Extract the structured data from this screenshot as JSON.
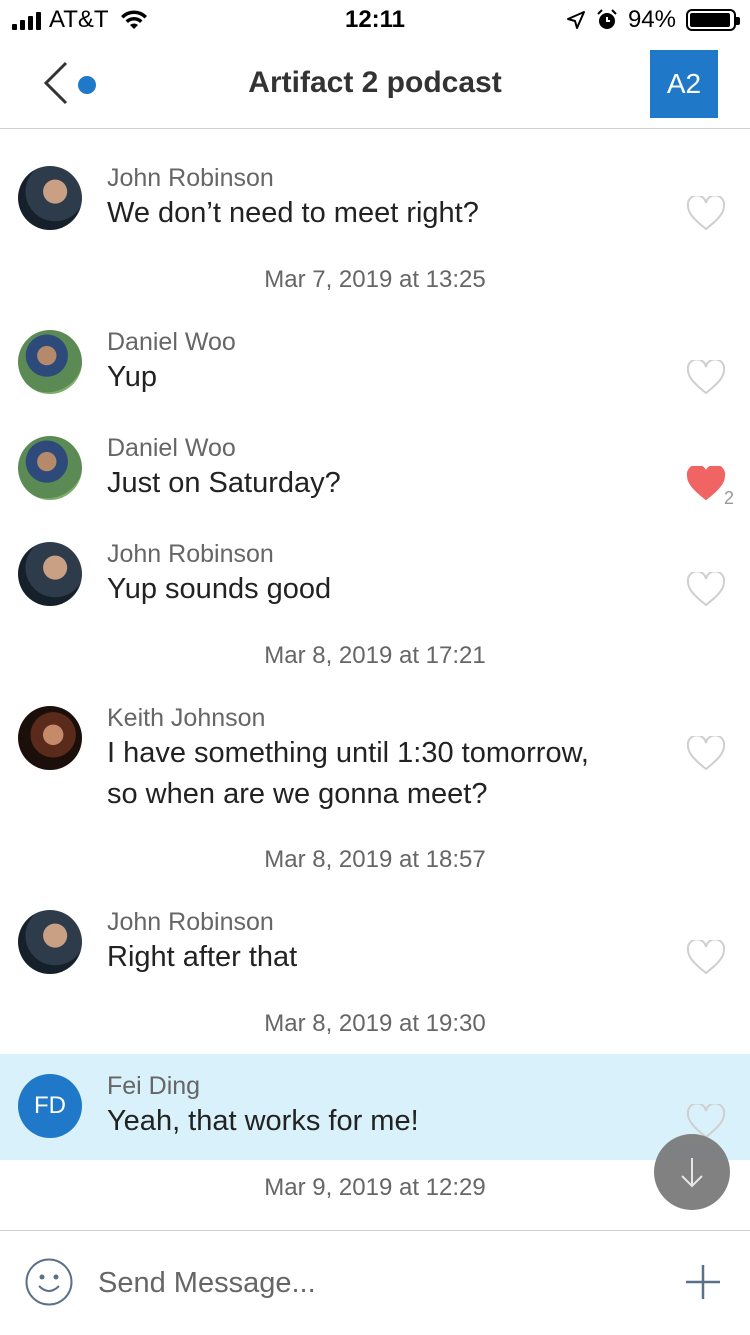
{
  "status_bar": {
    "carrier": "AT&T",
    "time": "12:11",
    "battery": "94%"
  },
  "nav": {
    "title": "Artifact 2 podcast",
    "group_initials": "A2"
  },
  "messages": [
    {
      "sender": "John Robinson",
      "text": "We don’t need to meet right?",
      "liked": false
    },
    {
      "timestamp": "Mar 7, 2019 at 13:25"
    },
    {
      "sender": "Daniel Woo",
      "text": "Yup",
      "liked": false
    },
    {
      "sender": "Daniel Woo",
      "text": "Just on Saturday?",
      "liked": true,
      "like_count": "2"
    },
    {
      "sender": "John Robinson",
      "text": "Yup sounds good",
      "liked": false
    },
    {
      "timestamp": "Mar 8, 2019 at 17:21"
    },
    {
      "sender": "Keith Johnson",
      "text_line1": "I have something until 1:30 tomorrow,",
      "text_line2": "so when are we gonna meet?",
      "liked": false
    },
    {
      "timestamp": "Mar 8, 2019 at 18:57"
    },
    {
      "sender": "John Robinson",
      "text": "Right after that",
      "liked": false
    },
    {
      "timestamp": "Mar 8, 2019 at 19:30"
    },
    {
      "sender": "Fei Ding",
      "initials": "FD",
      "text": "Yeah, that works for me!",
      "liked": false,
      "highlighted": true
    },
    {
      "timestamp": "Mar 9, 2019 at 12:29"
    }
  ],
  "composer": {
    "placeholder": "Send Message..."
  },
  "colors": {
    "accent": "#1f78c8",
    "like": "#f06464",
    "highlight": "#d9f1fa"
  },
  "icons": [
    "back-chevron-icon",
    "emoji-icon",
    "plus-icon",
    "heart-icon",
    "arrow-down-icon",
    "wifi-icon",
    "location-arrow-icon",
    "alarm-icon"
  ]
}
